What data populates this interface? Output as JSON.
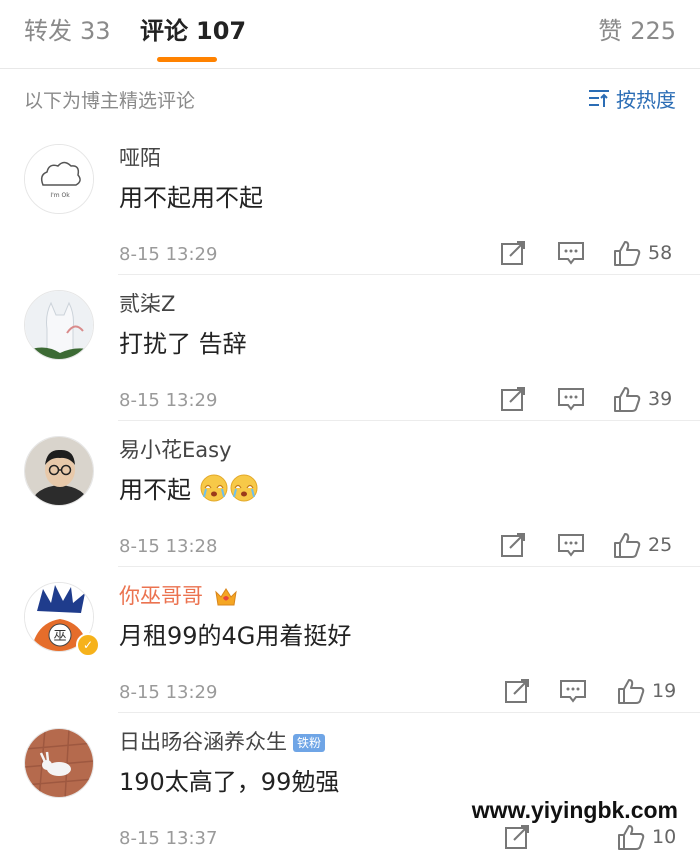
{
  "tabs": {
    "repost": {
      "label": "转发",
      "count": "33"
    },
    "comment": {
      "label": "评论",
      "count": "107"
    },
    "like": {
      "label": "赞",
      "count": "225"
    }
  },
  "selected": {
    "title": "以下为博主精选评论",
    "sort_label": "按热度"
  },
  "comments": [
    {
      "user": "哑陌",
      "text": "用不起用不起",
      "time": "8-15 13:29",
      "likes": "58"
    },
    {
      "user": "贰柒Z",
      "text": "打扰了 告辞",
      "time": "8-15 13:29",
      "likes": "39"
    },
    {
      "user": "易小花Easy",
      "text": "用不起",
      "time": "8-15 13:28",
      "likes": "25"
    },
    {
      "user": "你巫哥哥",
      "text": "月租99的4G用着挺好",
      "time": "8-15 13:29",
      "likes": "19"
    },
    {
      "user": "日出旸谷涵养众生",
      "badge": "铁粉",
      "text": "190太高了，99勉强",
      "time": "8-15 13:37",
      "likes": "10"
    }
  ],
  "avatar_text": {
    "cloud": "I'm Ok",
    "wu": "巫"
  },
  "watermark": "www.yiyingbk.com",
  "colors": {
    "accent": "#ff8200",
    "link": "#2b6db5",
    "vip_name": "#eb7350"
  }
}
